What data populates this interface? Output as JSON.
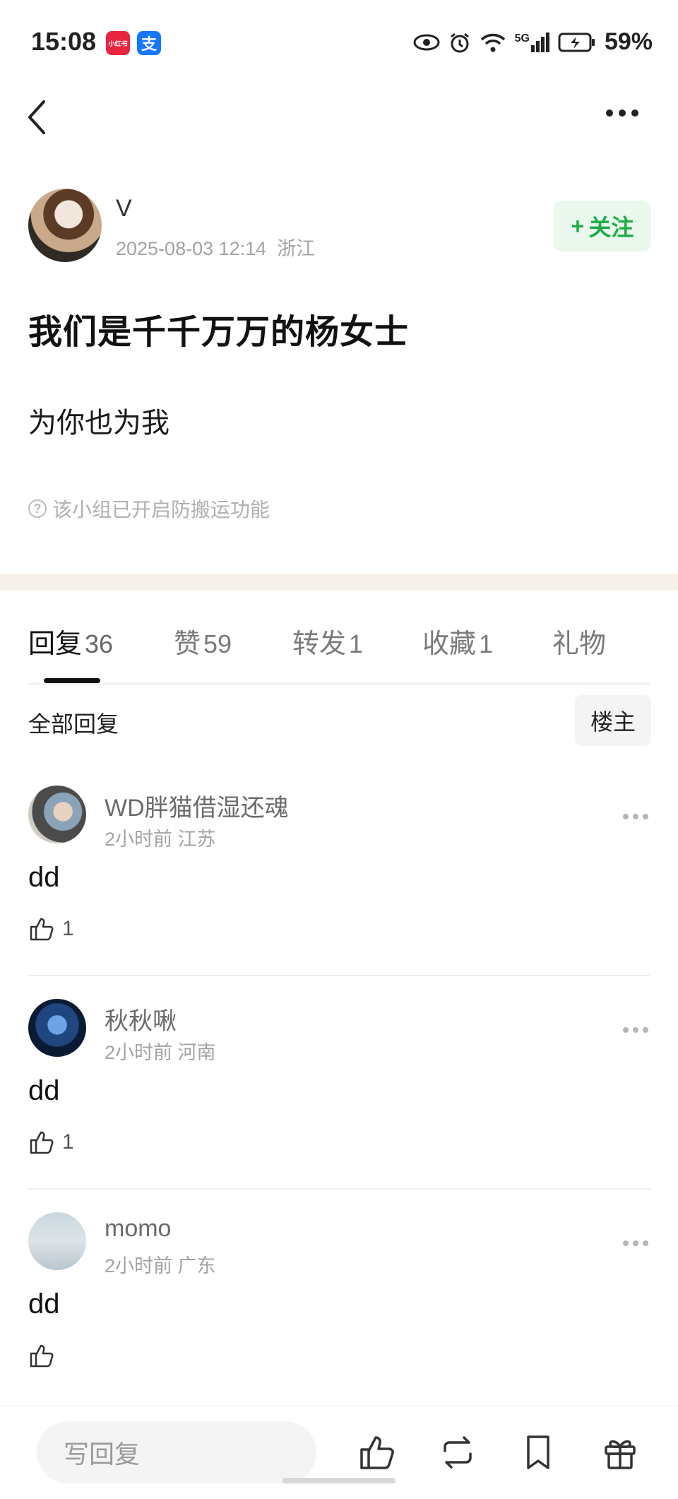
{
  "status_bar": {
    "time": "15:08",
    "badge_red": "小红书",
    "badge_blue": "支",
    "network": "5G",
    "battery": "59%"
  },
  "author": {
    "name": "V",
    "time": "2025-08-03 12:14",
    "location": "浙江",
    "follow_label": "关注",
    "follow_plus": "+"
  },
  "post": {
    "title": "我们是千千万万的杨女士",
    "body": "为你也为我",
    "notice_icon": "?",
    "notice": "该小组已开启防搬运功能"
  },
  "tabs": [
    {
      "label": "回复",
      "count": "36"
    },
    {
      "label": "赞",
      "count": "59"
    },
    {
      "label": "转发",
      "count": "1"
    },
    {
      "label": "收藏",
      "count": "1"
    },
    {
      "label": "礼物",
      "count": ""
    }
  ],
  "filter": {
    "label": "全部回复",
    "button": "楼主"
  },
  "comments": [
    {
      "name": "WD胖猫借湿还魂",
      "time": "2小时前",
      "location": "江苏",
      "text": "dd",
      "likes": "1"
    },
    {
      "name": "秋秋啾",
      "time": "2小时前",
      "location": "河南",
      "text": "dd",
      "likes": "1"
    },
    {
      "name": "momo",
      "time": "2小时前",
      "location": "广东",
      "text": "dd",
      "likes": ""
    }
  ],
  "bottom_bar": {
    "reply_placeholder": "写回复"
  },
  "colors": {
    "accent_green": "#1bac46",
    "follow_bg": "#eaf8ee",
    "divider_band": "#f5f1ea"
  },
  "icons": [
    "chevron-left-icon",
    "more-horizontal-icon",
    "eye-icon",
    "alarm-icon",
    "wifi-icon",
    "signal-icon",
    "battery-icon",
    "help-circle-icon",
    "thumb-up-icon",
    "repost-icon",
    "bookmark-icon",
    "gift-icon"
  ]
}
